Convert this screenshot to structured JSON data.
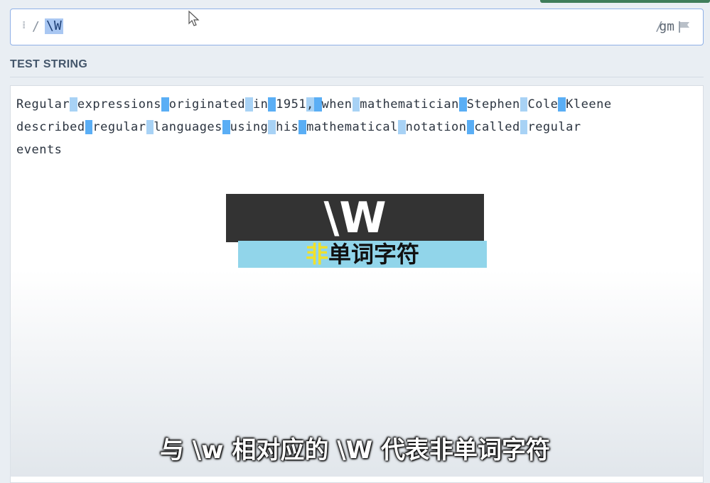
{
  "regex": {
    "drag_handle": "⁞",
    "open_delim": "/",
    "pattern": "\\W",
    "close_delim": "/",
    "flags": "gm"
  },
  "test_string": {
    "section_title": "TEST STRING",
    "line1": [
      "Regular",
      " ",
      "expressions",
      " ",
      "originated",
      " ",
      "in",
      " ",
      "1951",
      ",",
      " ",
      "when",
      " ",
      "mathematician",
      " ",
      "Stephen",
      " ",
      "Cole",
      " ",
      "Kleene",
      " "
    ],
    "line2": [
      "described",
      " ",
      "regular",
      " ",
      "languages",
      " ",
      "using",
      " ",
      "his",
      " ",
      "mathematical",
      " ",
      "notation",
      " ",
      "called",
      " ",
      "regular",
      " "
    ],
    "line3": [
      "events"
    ]
  },
  "overlay": {
    "title": "\\W",
    "caption_highlight": "非",
    "caption_rest": "单词字符"
  },
  "subtitle": "与 \\w 相对应的 \\W 代表非单词字符",
  "colors": {
    "match_light": "#a8d2f5",
    "match_dark": "#5aaef5",
    "regex_highlight": "#a9c7f2",
    "overlay_dark": "#333333",
    "overlay_cyan": "#91d5ea",
    "caption_highlight": "#f1e12a"
  }
}
